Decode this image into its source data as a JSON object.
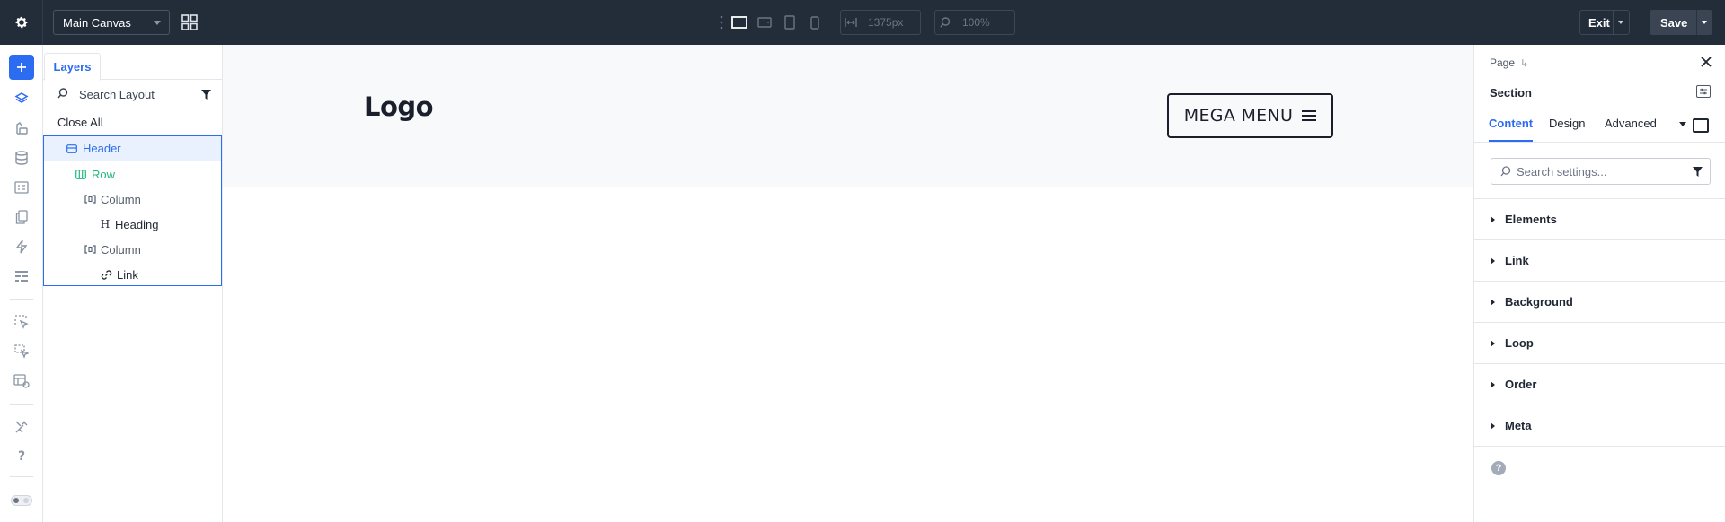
{
  "topbar": {
    "canvas_select": "Main Canvas",
    "width_value": "1375px",
    "zoom_value": "100%",
    "exit_label": "Exit",
    "save_label": "Save"
  },
  "layers": {
    "tab_label": "Layers",
    "search_placeholder": "Search Layout",
    "close_all": "Close All",
    "tree": [
      {
        "label": "Header",
        "icon": "header-icon"
      },
      {
        "label": "Row",
        "icon": "row-icon"
      },
      {
        "label": "Column",
        "icon": "column-icon"
      },
      {
        "label": "Heading",
        "icon": "heading-icon"
      },
      {
        "label": "Column",
        "icon": "column-icon"
      },
      {
        "label": "Link",
        "icon": "link-icon"
      }
    ]
  },
  "canvas": {
    "logo_text": "Logo",
    "menu_button": "MEGA MENU"
  },
  "settings": {
    "breadcrumb": "Page",
    "title": "Section",
    "tabs": [
      "Content",
      "Design",
      "Advanced"
    ],
    "search_placeholder": "Search settings...",
    "accordions": [
      "Elements",
      "Link",
      "Background",
      "Loop",
      "Order",
      "Meta"
    ],
    "help": "?"
  },
  "colors": {
    "topbar_bg": "#232c39",
    "accent": "#2c6cf0",
    "row_green": "#20b87a"
  }
}
